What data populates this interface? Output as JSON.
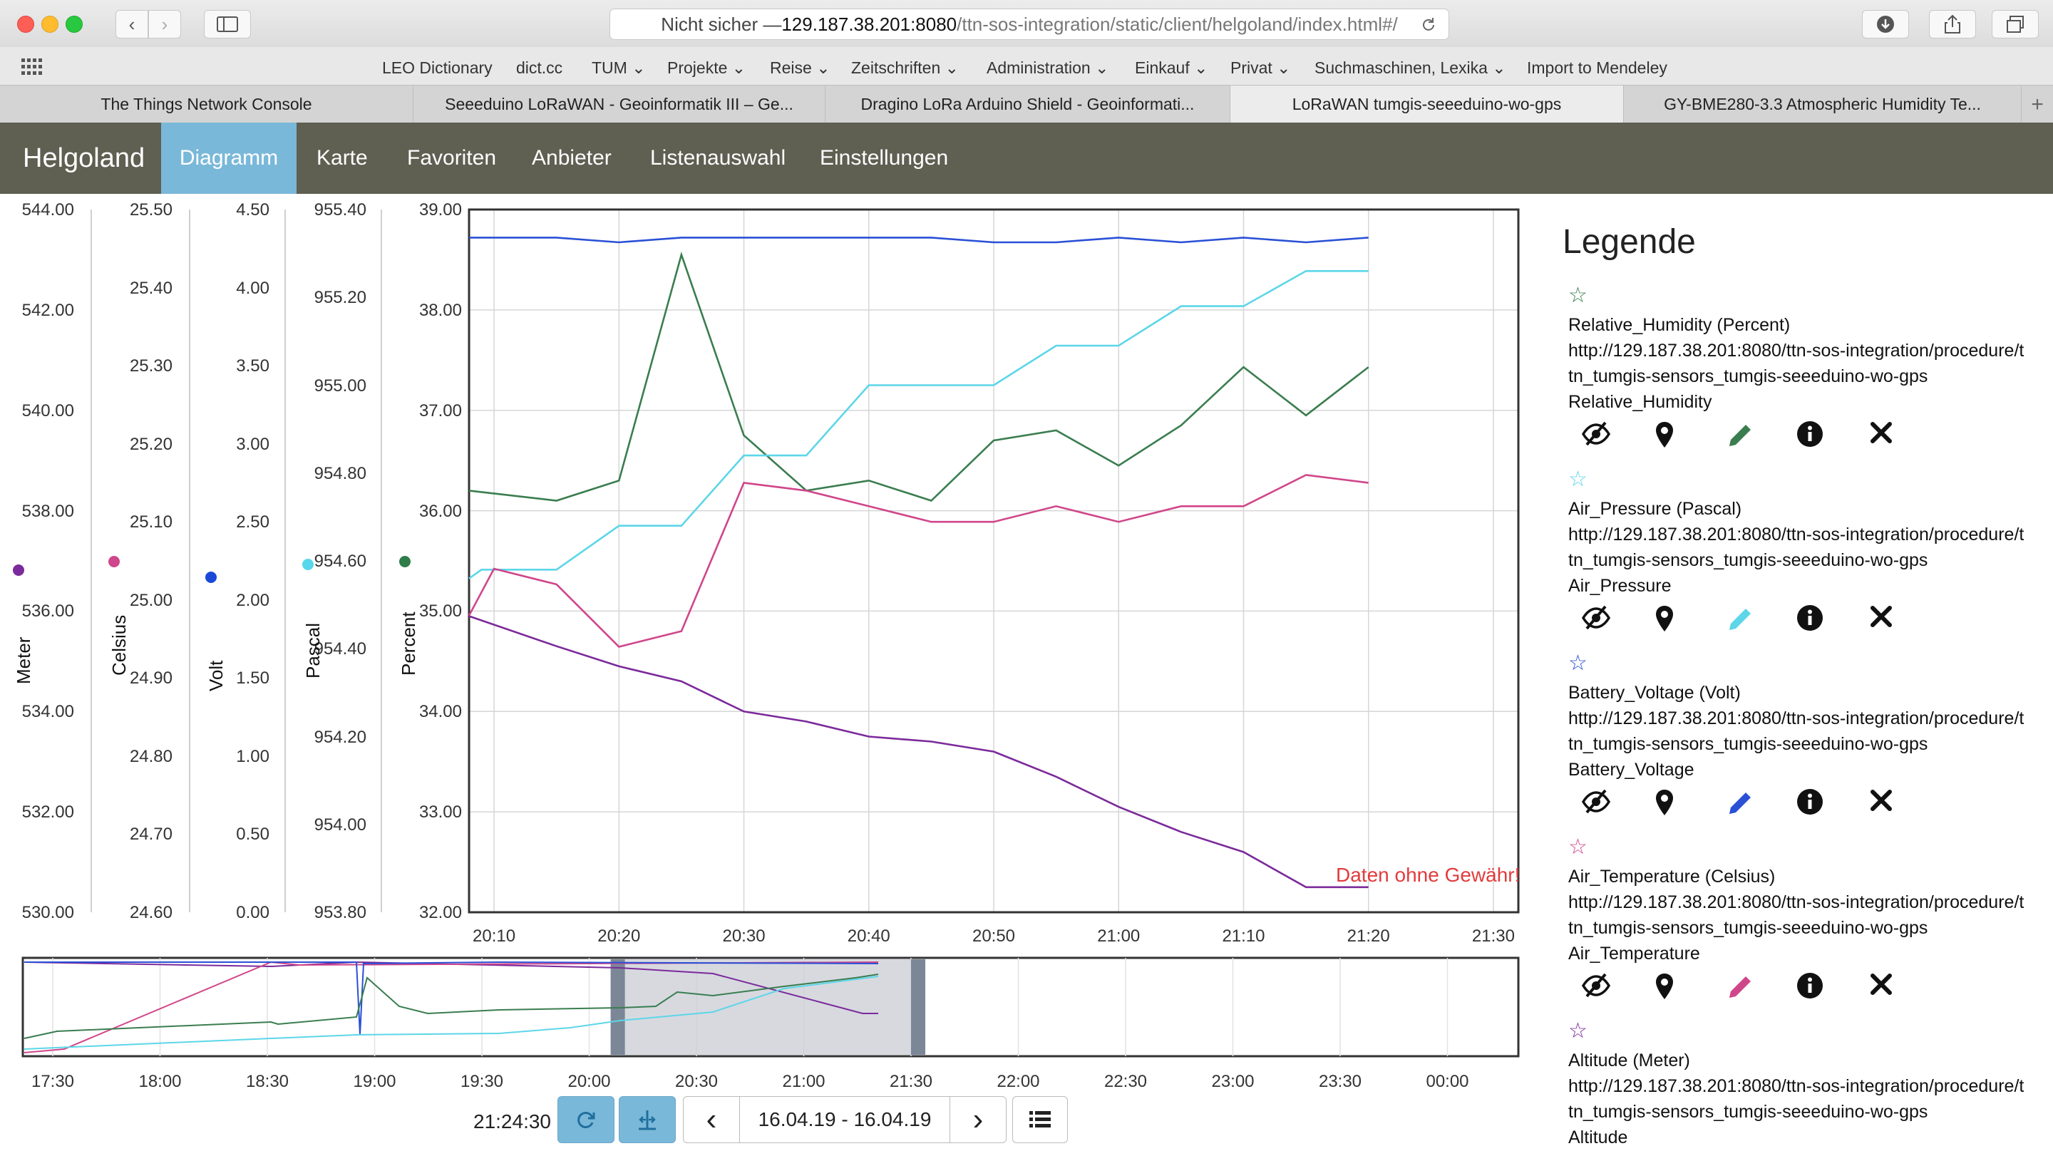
{
  "browser": {
    "url_prefix": "Nicht sicher — ",
    "url_host": "129.187.38.201:8080",
    "url_path": "/ttn-sos-integration/static/client/helgoland/index.html#/",
    "bookmarks": [
      "LEO Dictionary",
      "dict.cc",
      "TUM ⌄",
      "Projekte ⌄",
      "Reise ⌄",
      "Zeitschriften ⌄",
      "Administration ⌄",
      "Einkauf ⌄",
      "Privat ⌄",
      "Suchmaschinen, Lexika ⌄",
      "Import to Mendeley"
    ],
    "tabs": [
      {
        "label": "The Things Network Console",
        "active": false
      },
      {
        "label": "Seeeduino LoRaWAN - Geoinformatik III – Ge...",
        "active": false
      },
      {
        "label": "Dragino LoRa Arduino Shield - Geoinformati...",
        "active": false
      },
      {
        "label": "LoRaWAN tumgis-seeeduino-wo-gps",
        "active": true
      },
      {
        "label": "GY-BME280-3.3 Atmospheric Humidity Te...",
        "active": false
      }
    ],
    "new_tab_label": "+"
  },
  "app": {
    "brand": "Helgoland",
    "nav": [
      "Diagramm",
      "Karte",
      "Favoriten",
      "Anbieter",
      "Listenauswahl",
      "Einstellungen"
    ],
    "active_nav": "Diagramm"
  },
  "chart_data": {
    "type": "line",
    "watermark": "Daten ohne Gewähr!",
    "x_tick_labels": [
      "20:10",
      "20:20",
      "20:30",
      "20:40",
      "20:50",
      "21:00",
      "21:10",
      "21:20",
      "21:30"
    ],
    "x_minutes_range": [
      "20:08",
      "21:32"
    ],
    "axes": [
      {
        "unit": "Meter",
        "color": "#7b2a9b",
        "ticks": [
          "544.00",
          "542.00",
          "540.00",
          "538.00",
          "536.00",
          "534.00",
          "532.00",
          "530.00"
        ],
        "range": [
          530,
          544
        ]
      },
      {
        "unit": "Celsius",
        "color": "#d0468a",
        "ticks": [
          "25.50",
          "25.40",
          "25.30",
          "25.20",
          "25.10",
          "25.00",
          "24.90",
          "24.80",
          "24.70",
          "24.60"
        ],
        "range": [
          24.6,
          25.5
        ]
      },
      {
        "unit": "Volt",
        "color": "#1a49d8",
        "ticks": [
          "4.50",
          "4.00",
          "3.50",
          "3.00",
          "2.50",
          "2.00",
          "1.50",
          "1.00",
          "0.50",
          "0.00"
        ],
        "range": [
          0,
          4.5
        ]
      },
      {
        "unit": "Pascal",
        "color": "#56d8ea",
        "ticks": [
          "955.40",
          "955.20",
          "955.00",
          "954.80",
          "954.60",
          "954.40",
          "954.20",
          "954.00",
          "953.80"
        ],
        "range": [
          953.8,
          955.4
        ]
      },
      {
        "unit": "Percent",
        "color": "#2f7d4a",
        "ticks": [
          "39.00",
          "38.00",
          "37.00",
          "36.00",
          "35.00",
          "34.00",
          "33.00",
          "32.00"
        ],
        "range": [
          32,
          39
        ]
      }
    ],
    "series": [
      {
        "name": "Relative_Humidity (Percent)",
        "axis": 4,
        "color": "#3a7d4f",
        "x": [
          "20:08",
          "20:15",
          "20:20",
          "20:25",
          "20:30",
          "20:35",
          "20:40",
          "20:45",
          "20:50",
          "20:55",
          "21:00",
          "21:05",
          "21:10",
          "21:15",
          "21:20"
        ],
        "values": [
          36.2,
          36.1,
          36.3,
          38.55,
          36.75,
          36.2,
          36.3,
          36.1,
          36.7,
          36.8,
          36.45,
          36.85,
          37.43,
          36.95,
          37.43
        ]
      },
      {
        "name": "Air_Pressure (Pascal)",
        "axis": 3,
        "color": "#5cd6e8",
        "x": [
          "20:08",
          "20:09",
          "20:15",
          "20:20",
          "20:25",
          "20:30",
          "20:35",
          "20:40",
          "20:45",
          "20:50",
          "20:55",
          "21:00",
          "21:05",
          "21:10",
          "21:15",
          "21:20"
        ],
        "values": [
          954.56,
          954.58,
          954.58,
          954.68,
          954.68,
          954.84,
          954.84,
          955.0,
          955.0,
          955.0,
          955.09,
          955.09,
          955.18,
          955.18,
          955.26,
          955.26
        ]
      },
      {
        "name": "Battery_Voltage (Volt)",
        "axis": 2,
        "color": "#2a50d6",
        "x": [
          "20:08",
          "20:15",
          "20:20",
          "20:25",
          "20:30",
          "20:35",
          "20:40",
          "20:45",
          "20:50",
          "20:55",
          "21:00",
          "21:05",
          "21:10",
          "21:15",
          "21:20"
        ],
        "values": [
          4.32,
          4.32,
          4.29,
          4.32,
          4.32,
          4.32,
          4.32,
          4.32,
          4.29,
          4.29,
          4.32,
          4.29,
          4.32,
          4.29,
          4.32
        ]
      },
      {
        "name": "Air_Temperature (Celsius)",
        "axis": 1,
        "color": "#d0468a",
        "x": [
          "20:08",
          "20:10",
          "20:15",
          "20:20",
          "20:25",
          "20:30",
          "20:35",
          "20:40",
          "20:45",
          "20:50",
          "20:55",
          "21:00",
          "21:05",
          "21:10",
          "21:15",
          "21:20"
        ],
        "values": [
          24.98,
          25.04,
          25.02,
          24.94,
          24.96,
          25.15,
          25.14,
          25.12,
          25.1,
          25.1,
          25.12,
          25.1,
          25.12,
          25.12,
          25.16,
          25.15
        ]
      },
      {
        "name": "Altitude (Meter)",
        "axis": 0,
        "color": "#7b2a9b",
        "x": [
          "20:08",
          "20:15",
          "20:20",
          "20:25",
          "20:30",
          "20:35",
          "20:40",
          "20:45",
          "20:50",
          "20:55",
          "21:00",
          "21:05",
          "21:10",
          "21:15",
          "21:20"
        ],
        "values": [
          535.9,
          535.3,
          534.9,
          534.6,
          534.0,
          533.8,
          533.5,
          533.4,
          533.2,
          532.7,
          532.1,
          531.6,
          531.2,
          530.5,
          530.5
        ]
      }
    ],
    "overview": {
      "tick_labels": [
        "17:30",
        "18:00",
        "18:30",
        "19:00",
        "19:30",
        "20:00",
        "20:30",
        "21:00",
        "21:30",
        "22:00",
        "22:30",
        "23:00",
        "23:30",
        "00:00"
      ],
      "selection": [
        "20:08",
        "21:32"
      ]
    }
  },
  "legend": {
    "title": "Legende",
    "entries": [
      {
        "star": "☆",
        "color": "#3a7d4f",
        "name": "Relative_Humidity (Percent)",
        "url": "http://129.187.38.201:8080/ttn-sos-integration/procedure/ttn_tumgis-sensors_tumgis-seeeduino-wo-gps",
        "phenomenon": "Relative_Humidity",
        "icons": [
          "hide-icon",
          "location-icon",
          "edit-icon",
          "info-icon",
          "close-icon"
        ]
      },
      {
        "star": "☆",
        "color": "#5cd6e8",
        "name": "Air_Pressure (Pascal)",
        "url": "http://129.187.38.201:8080/ttn-sos-integration/procedure/ttn_tumgis-sensors_tumgis-seeeduino-wo-gps",
        "phenomenon": "Air_Pressure",
        "icons": [
          "hide-icon",
          "location-icon",
          "edit-icon",
          "info-icon",
          "close-icon"
        ]
      },
      {
        "star": "☆",
        "color": "#2a50d6",
        "name": "Battery_Voltage (Volt)",
        "url": "http://129.187.38.201:8080/ttn-sos-integration/procedure/ttn_tumgis-sensors_tumgis-seeeduino-wo-gps",
        "phenomenon": "Battery_Voltage",
        "icons": [
          "hide-icon",
          "location-icon",
          "edit-icon",
          "info-icon",
          "close-icon"
        ]
      },
      {
        "star": "☆",
        "color": "#d0468a",
        "name": "Air_Temperature (Celsius)",
        "url": "http://129.187.38.201:8080/ttn-sos-integration/procedure/ttn_tumgis-sensors_tumgis-seeeduino-wo-gps",
        "phenomenon": "Air_Temperature",
        "icons": [
          "hide-icon",
          "location-icon",
          "edit-icon",
          "info-icon",
          "close-icon"
        ]
      },
      {
        "star": "☆",
        "color": "#7b2a9b",
        "name": "Altitude (Meter)",
        "url": "http://129.187.38.201:8080/ttn-sos-integration/procedure/ttn_tumgis-sensors_tumgis-seeeduino-wo-gps",
        "phenomenon": "Altitude",
        "icons": []
      }
    ]
  },
  "controls": {
    "time": "21:24:30",
    "timespan": "16.04.19 - 16.04.19",
    "prev_icon": "‹",
    "next_icon": "›",
    "refresh_icon": "refresh-icon",
    "zoom_icon": "zoom-icon",
    "list_icon": "list-icon"
  }
}
